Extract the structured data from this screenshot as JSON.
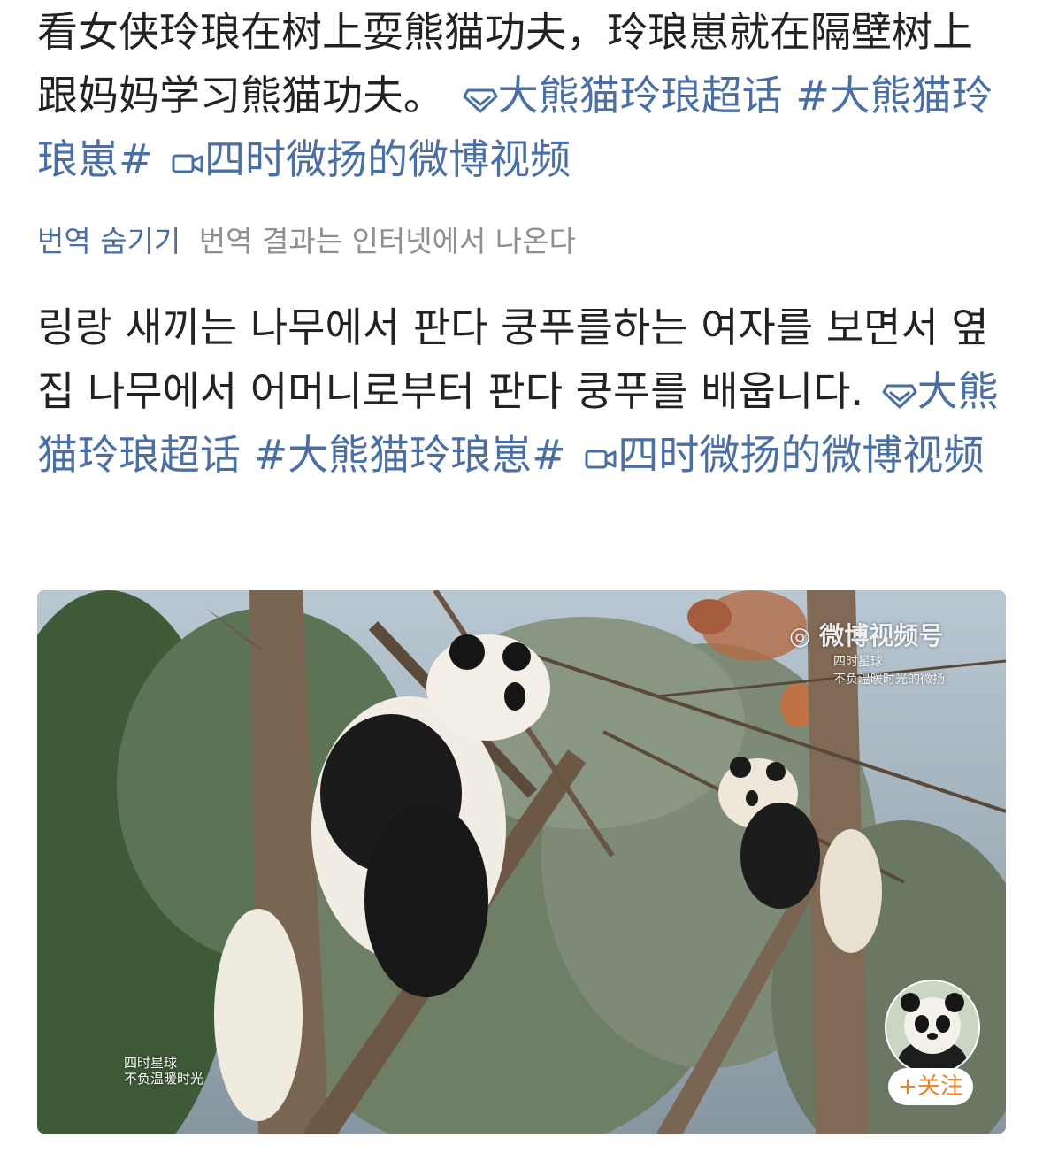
{
  "original_post": {
    "text": "看女侠玲琅在树上耍熊猫功夫，玲琅崽就在隔壁树上跟妈妈学习熊猫功夫。",
    "supertopic": "大熊猫玲琅超话",
    "hashtag": "#大熊猫玲琅崽#",
    "video_link": "四时微扬的微博视频"
  },
  "translation_bar": {
    "toggle_label": "번역 숨기기",
    "source_note": "번역 결과는 인터넷에서 나온다"
  },
  "translated_post": {
    "text": "링랑 새끼는 나무에서 판다 쿵푸를하는 여자를 보면서 옆집 나무에서 어머니로부터 판다 쿵푸를 배웁니다.",
    "supertopic": "大熊猫玲琅超话",
    "hashtag": "#大熊猫玲琅崽#",
    "video_link": "四时微扬的微博视频"
  },
  "video_card": {
    "watermark_left_line1": "四时星球",
    "watermark_left_line2": "不负温暖时光",
    "watermark_right_logo": "微博视频号",
    "watermark_right_line1": "四时星球",
    "watermark_right_line2": "不负温暖时光的微扬",
    "follow_label": "+关注"
  },
  "colors": {
    "link": "#4a6fa5",
    "text": "#222222",
    "muted": "#8f8f8f",
    "follow": "#f08020"
  },
  "icons": {
    "supertopic": "diamond-icon",
    "video": "video-camera-icon"
  }
}
